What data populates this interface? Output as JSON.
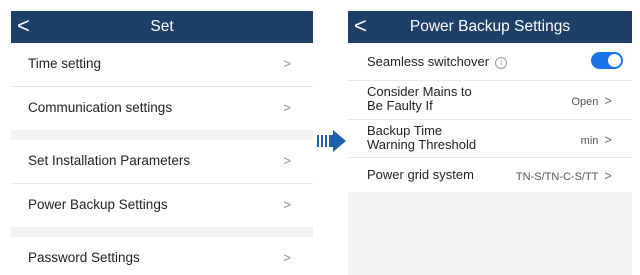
{
  "left": {
    "title": "Set",
    "back_glyph": "<",
    "group1": [
      {
        "label": "Time setting"
      },
      {
        "label": "Communication settings"
      }
    ],
    "group2": [
      {
        "label": "Set Installation Parameters"
      },
      {
        "label": "Power Backup Settings"
      }
    ],
    "group3": [
      {
        "label": "Password Settings"
      }
    ],
    "chevron": ">"
  },
  "right": {
    "title": "Power Backup Settings",
    "back_glyph": "<",
    "seamless": {
      "label": "Seamless switchover",
      "info_glyph": "i",
      "enabled": true
    },
    "mains": {
      "label_line1": "Consider Mains to",
      "label_line2": "Be Faulty If",
      "value": "Open"
    },
    "backup": {
      "label_line1": "Backup Time",
      "label_line2": "Warning Threshold",
      "value": "min"
    },
    "grid": {
      "label": "Power grid system",
      "value": "TN-S/TN-C-S/TT"
    },
    "chevron": ">"
  },
  "colors": {
    "header": "#1e3f68",
    "accent": "#1a73e8",
    "arrow": "#1f5fae",
    "background": "#f1f2f4"
  }
}
